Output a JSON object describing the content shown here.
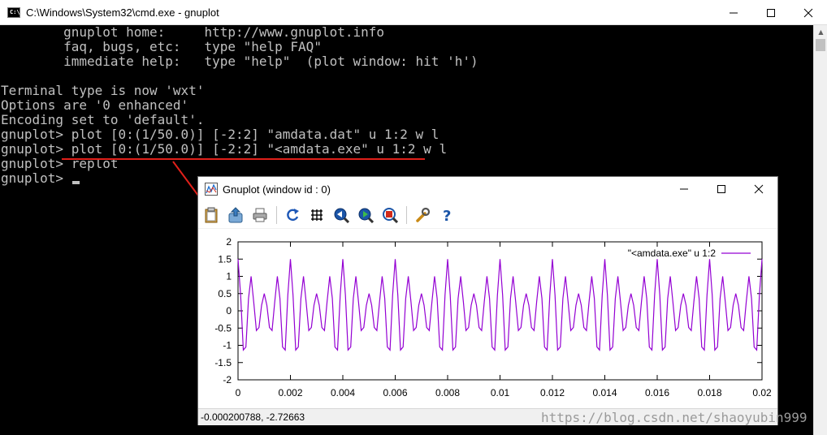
{
  "cmd": {
    "title": "C:\\Windows\\System32\\cmd.exe - gnuplot",
    "icon": "cmd-icon",
    "icon_text": "C:\\",
    "lines": [
      "        gnuplot home:     http://www.gnuplot.info",
      "        faq, bugs, etc:   type \"help FAQ\"",
      "        immediate help:   type \"help\"  (plot window: hit 'h')",
      "",
      "Terminal type is now 'wxt'",
      "Options are '0 enhanced'",
      "Encoding set to 'default'.",
      "gnuplot> plot [0:(1/50.0)] [-2:2] \"amdata.dat\" u 1:2 w l",
      "gnuplot> plot [0:(1/50.0)] [-2:2] \"<amdata.exe\" u 1:2 w l",
      "gnuplot> replot",
      "gnuplot> "
    ]
  },
  "gnuplot_window": {
    "title": "Gnuplot (window id : 0)",
    "status": "-0.000200788, -2.72663",
    "toolbar": [
      "copy-clipboard-icon",
      "export-icon",
      "print-icon",
      "replot-icon",
      "grid-icon",
      "previous-zoom-icon",
      "next-zoom-icon",
      "autoscale-icon",
      "config-icon",
      "help-icon"
    ]
  },
  "chart_data": {
    "type": "line",
    "series": [
      {
        "name": "\"<amdata.exe\" u 1:2",
        "color": "#9400d3"
      }
    ],
    "xlim": [
      0,
      0.02
    ],
    "ylim": [
      -2,
      2
    ],
    "xticks": [
      "0",
      "0.002",
      "0.004",
      "0.006",
      "0.008",
      "0.01",
      "0.012",
      "0.014",
      "0.016",
      "0.018",
      "0.02"
    ],
    "yticks": [
      "2",
      "1.5",
      "1",
      "0.5",
      "0",
      "-0.5",
      "-1",
      "-1.5",
      "-2"
    ],
    "carrier_hz": 2000,
    "envelope_hz": 500,
    "sample_step": 0.0001,
    "legend": "top-right",
    "grid": false
  },
  "watermark": "https://blog.csdn.net/shaoyubin999",
  "colors": {
    "annotation": "#e0201a",
    "series": "#9400d3"
  }
}
